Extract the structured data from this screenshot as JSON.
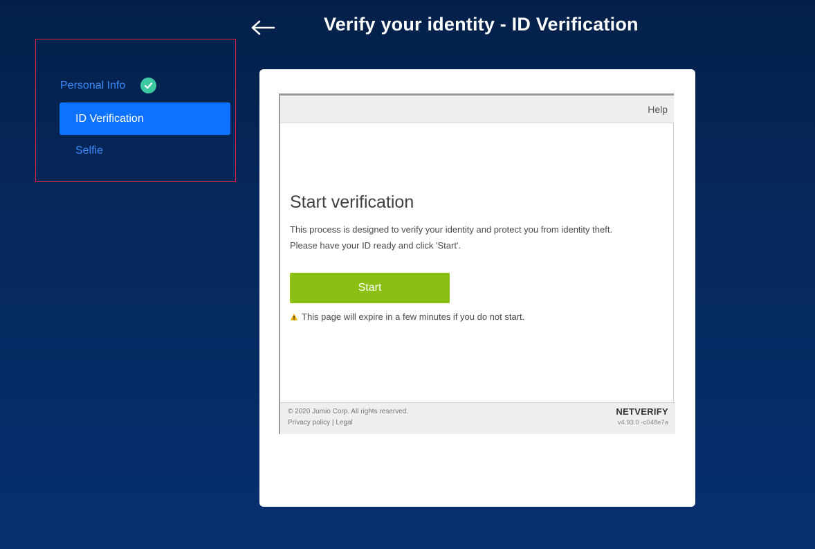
{
  "header": {
    "title": "Verify your identity - ID Verification",
    "back_icon": "left-arrow-icon"
  },
  "steps": {
    "items": [
      {
        "label": "Personal Info",
        "status": "completed",
        "icon": "check-circle-icon"
      },
      {
        "label": "ID Verification",
        "status": "active"
      },
      {
        "label": "Selfie",
        "status": "pending"
      }
    ],
    "highlight_color": "#e0243a",
    "active_color": "#0d72ff",
    "check_color": "#3cc8a0"
  },
  "widget": {
    "help_label": "Help",
    "heading": "Start verification",
    "description_line1": "This process is designed to verify your identity and protect you from identity theft.",
    "description_line2": "Please have your ID ready and click 'Start'.",
    "start_label": "Start",
    "start_color": "#8cbf14",
    "warning_icon": "warning-icon",
    "warning_text": "This page will expire in a few minutes if you do not start.",
    "footer": {
      "copyright": "© 2020 Jumio Corp. All rights reserved.",
      "privacy_label": "Privacy policy",
      "separator": "|",
      "legal_label": "Legal",
      "brand": "NETVERIFY",
      "version": "v4.93.0 -c048e7a"
    }
  }
}
